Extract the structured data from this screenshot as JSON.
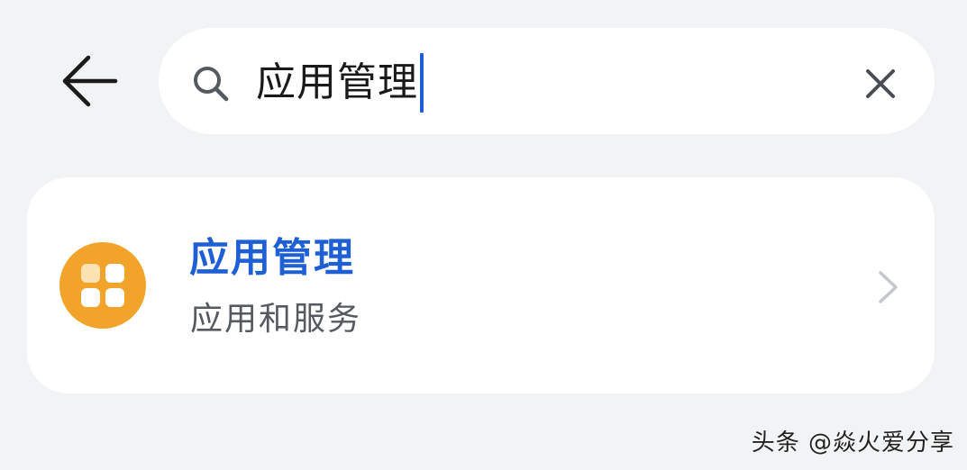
{
  "header": {
    "back_icon": "arrow-left-icon",
    "clear_icon": "close-icon"
  },
  "search": {
    "icon": "search-icon",
    "value": "应用管理"
  },
  "results": [
    {
      "title": "应用管理",
      "subtitle": "应用和服务",
      "icon": "app-grid-icon",
      "icon_color": "#f2a42a",
      "chevron_icon": "chevron-right-icon"
    }
  ],
  "colors": {
    "accent": "#1e5fd6",
    "background": "#f1f3f5",
    "card": "#ffffff"
  },
  "watermark": {
    "text": "头条 @焱火爱分享"
  }
}
